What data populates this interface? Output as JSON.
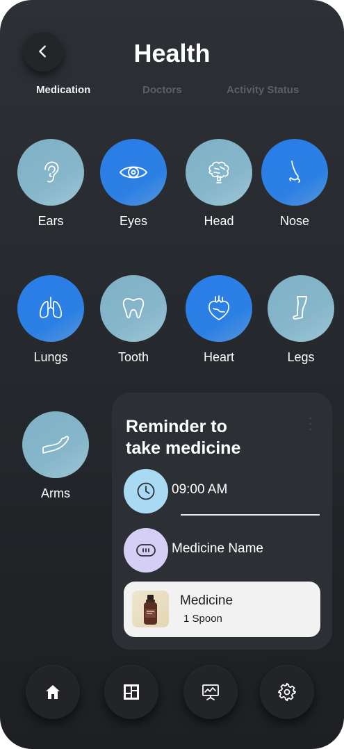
{
  "header": {
    "title": "Health",
    "back_icon": "chevron-left-icon"
  },
  "tabs": [
    {
      "label": "Medication",
      "active": true
    },
    {
      "label": "Doctors",
      "active": false
    },
    {
      "label": "Activity Status",
      "active": false
    }
  ],
  "organs": [
    {
      "label": "Ears",
      "icon": "ear-icon",
      "style": "light"
    },
    {
      "label": "Eyes",
      "icon": "eye-icon",
      "style": "blue"
    },
    {
      "label": "Head",
      "icon": "brain-icon",
      "style": "light"
    },
    {
      "label": "Nose",
      "icon": "nose-icon",
      "style": "blue"
    },
    {
      "label": "Lungs",
      "icon": "lungs-icon",
      "style": "blue"
    },
    {
      "label": "Tooth",
      "icon": "tooth-icon",
      "style": "light"
    },
    {
      "label": "Heart",
      "icon": "heart-icon",
      "style": "blue"
    },
    {
      "label": "Legs",
      "icon": "leg-icon",
      "style": "light"
    },
    {
      "label": "Arms",
      "icon": "arm-icon",
      "style": "light"
    }
  ],
  "reminder": {
    "title_line1": "Reminder to",
    "title_line2": "take medicine",
    "time": "09:00 AM",
    "medicine_name_label": "Medicine Name",
    "medicine": {
      "name": "Medicine",
      "dose": "1 Spoon"
    }
  },
  "bottom_nav": [
    {
      "icon": "home-icon"
    },
    {
      "icon": "dashboard-icon"
    },
    {
      "icon": "presentation-chart-icon"
    },
    {
      "icon": "settings-icon"
    }
  ],
  "colors": {
    "background": "#26292d",
    "accent_blue": "#2a7de7",
    "accent_light": "#86b6ca",
    "card": "#2c2f34"
  }
}
